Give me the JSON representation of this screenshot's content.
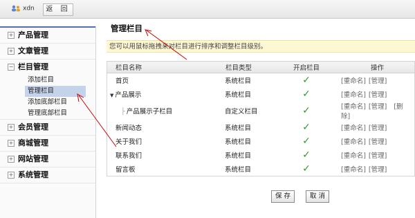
{
  "topbar": {
    "username": "xdn",
    "back_label": "返 回"
  },
  "sidebar": {
    "categories": [
      {
        "label": "产品管理"
      },
      {
        "label": "文章管理"
      },
      {
        "label": "栏目管理",
        "subitems": [
          "添加栏目",
          "管理栏目",
          "添加底部栏目",
          "管理底部栏目"
        ]
      },
      {
        "label": "会员管理"
      },
      {
        "label": "商城管理"
      },
      {
        "label": "网站管理"
      },
      {
        "label": "系统管理"
      }
    ],
    "active_subitem": "管理栏目"
  },
  "main": {
    "title": "管理栏目",
    "hint": "您可以用鼠标拖拽来对栏目进行排序和调整栏目级别。",
    "table": {
      "headers": [
        "栏目名称",
        "栏目类型",
        "开启栏目",
        "操作"
      ],
      "rows": [
        {
          "name": "首页",
          "type": "系统栏目",
          "enabled": true,
          "ops": [
            "[重命名]",
            "[管理]"
          ]
        },
        {
          "name": "产品展示",
          "type": "系统栏目",
          "enabled": true,
          "ops": [
            "[重命名]",
            "[管理]"
          ]
        },
        {
          "name": "产品展示子栏目",
          "type": "自定义栏目",
          "enabled": true,
          "ops": [
            "[重命名]",
            "[管理]",
            "[删除]"
          ]
        },
        {
          "name": "新闻动态",
          "type": "系统栏目",
          "enabled": true,
          "ops": [
            "[重命名]",
            "[管理]"
          ]
        },
        {
          "name": "关于我们",
          "type": "系统栏目",
          "enabled": true,
          "ops": [
            "[重命名]",
            "[管理]"
          ]
        },
        {
          "name": "联系我们",
          "type": "系统栏目",
          "enabled": true,
          "ops": [
            "[重命名]",
            "[管理]"
          ]
        },
        {
          "name": "留言板",
          "type": "系统栏目",
          "enabled": true,
          "ops": [
            "[重命名]",
            "[管理]"
          ]
        }
      ]
    },
    "save_label": "保 存",
    "cancel_label": "取 消"
  },
  "colors": {
    "accent": "#4e6fb3",
    "check": "#2e9a2e",
    "hint_bg": "#fdf7d4",
    "active_bg": "#c5d3ea",
    "annotation": "#cc0000"
  }
}
